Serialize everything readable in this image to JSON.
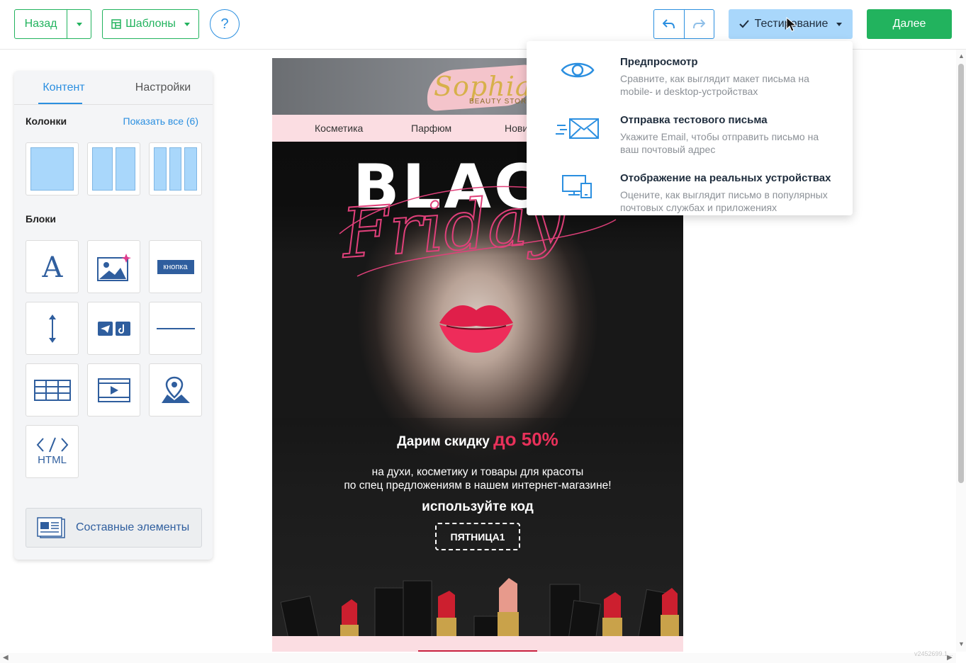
{
  "toolbar": {
    "back_label": "Назад",
    "templates_label": "Шаблоны",
    "help_label": "?",
    "testing_label": "Тестирование",
    "next_label": "Далее"
  },
  "panel": {
    "tabs": [
      {
        "label": "Контент",
        "active": true
      },
      {
        "label": "Настройки",
        "active": false
      }
    ],
    "columns_title": "Колонки",
    "show_all": "Показать все (6)",
    "blocks_title": "Блоки",
    "button_block_label": "кнопка",
    "html_block_label": "HTML",
    "compound_label": "Составные элементы"
  },
  "email": {
    "logo_text": "Sophia",
    "logo_sub": "BEAUTY STORE",
    "nav": [
      "Косметика",
      "Парфюм",
      "Нови"
    ],
    "hero_title": "BLAC",
    "hero_script": "Friday",
    "promo_prefix": "Дарим скидку",
    "promo_accent": "до 50%",
    "promo_desc_1": "на духи, косметику и товары для красоты",
    "promo_desc_2": "по спец предложениям в нашем интернет-магазине!",
    "use_code": "используйте код",
    "code": "ПЯТНИЦА1"
  },
  "dropdown": {
    "items": [
      {
        "title": "Предпросмотр",
        "desc": "Сравните, как выглядит макет письма на mobile- и desktop-устройствах",
        "icon": "eye-icon"
      },
      {
        "title": "Отправка тестового письма",
        "desc": "Укажите Email, чтобы отправить письмо на ваш почтовый адрес",
        "icon": "envelope-icon"
      },
      {
        "title": "Отображение на реальных устройствах",
        "desc": "Оцените, как выглядит письмо в популярных почтовых службах и приложениях",
        "icon": "devices-icon"
      }
    ]
  },
  "version": "v2452699.1...",
  "colors": {
    "green": "#22b35e",
    "blue": "#2b8fe0",
    "testing_bg": "#a9d7fb",
    "pink": "#fbdde2",
    "accent_red": "#e8315a"
  }
}
